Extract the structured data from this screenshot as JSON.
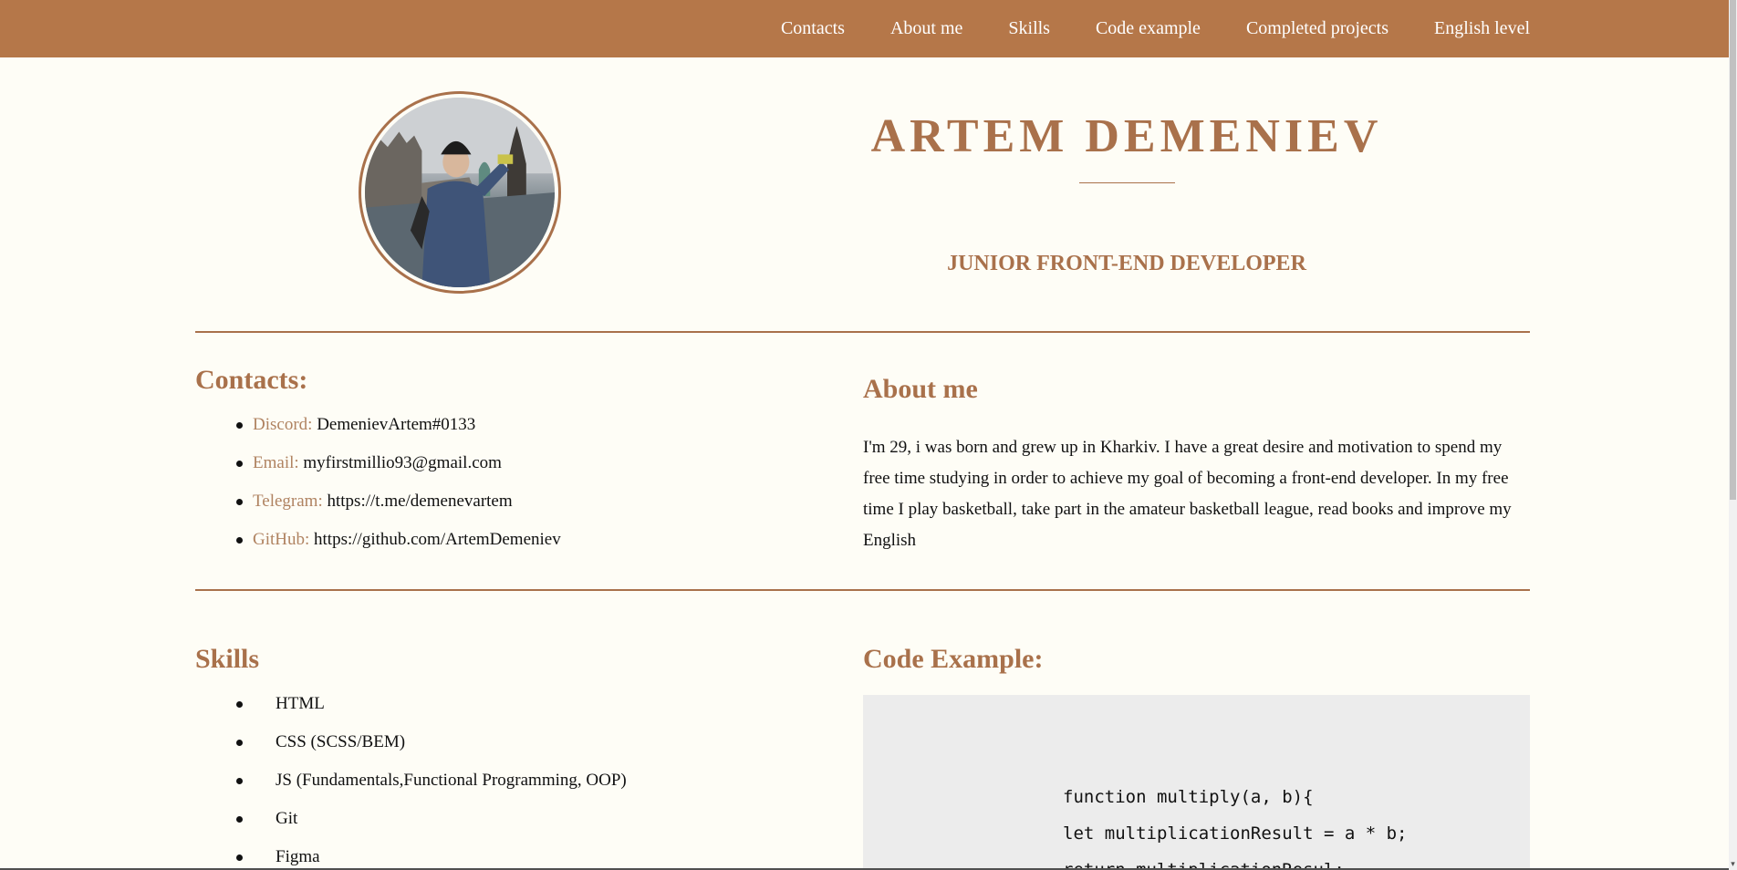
{
  "nav": {
    "items": [
      "Contacts",
      "About me",
      "Skills",
      "Code example",
      "Completed projects",
      "English level"
    ]
  },
  "header": {
    "avatar_icon": "profile-photo",
    "name": "ARTEM DEMENIEV",
    "title": "JUNIOR FRONT-END DEVELOPER"
  },
  "contacts": {
    "heading": "Contacts:",
    "items": [
      {
        "label": "Discord:",
        "value": "DemenievArtem#0133"
      },
      {
        "label": "Email:",
        "value": "myfirstmillio93@gmail.com"
      },
      {
        "label": "Telegram:",
        "value": "https://t.me/demenevartem"
      },
      {
        "label": "GitHub:",
        "value": "https://github.com/ArtemDemeniev"
      }
    ]
  },
  "about": {
    "heading": "About me",
    "text": "I'm 29, i was born and grew up in Kharkiv. I have a great desire and motivation to spend my free time studying in order to achieve my goal of becoming a front-end developer. In my free time I play basketball, take part in the amateur basketball league, read books and improve my English"
  },
  "skills": {
    "heading": "Skills",
    "items": [
      "HTML",
      "CSS (SCSS/BEM)",
      "JS (Fundamentals,Functional Programming, OOP)",
      "Git",
      "Figma"
    ]
  },
  "code_example": {
    "heading": "Code Example:",
    "lines": [
      "function multiply(a, b){",
      "let multiplicationResult = a * b;",
      "return multiplicationResul;"
    ]
  },
  "colors": {
    "accent": "#a9714b",
    "nav_bg": "#b57749",
    "page_bg": "#fefdf6",
    "code_bg": "#ececec"
  }
}
